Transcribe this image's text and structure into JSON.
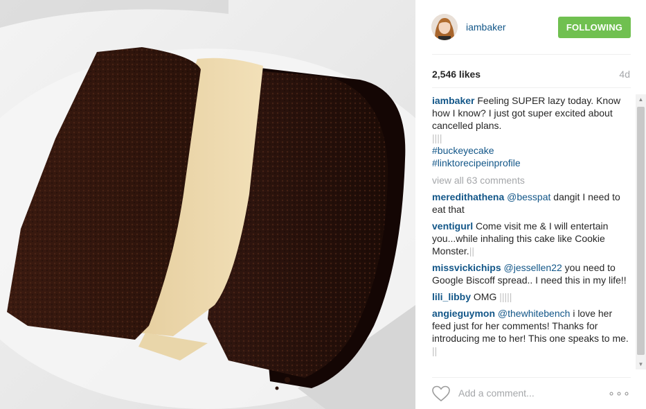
{
  "post": {
    "image_alt": "chocolate layer cake slice with peanut butter filling",
    "author": "iambaker",
    "follow_label": "FOLLOWING",
    "likes": "2,546 likes",
    "age": "4d"
  },
  "caption": {
    "user": "iambaker",
    "text": "Feeling SUPER lazy today. Know how I know? I just got super excited about cancelled plans.",
    "emoji_row": "||||",
    "tags": [
      "#buckeyecake",
      "#linktorecipeinprofile"
    ]
  },
  "view_all": "view all 63 comments",
  "comments": [
    {
      "user": "meredithathena",
      "mention": "@besspat",
      "text": "dangit I need to eat that"
    },
    {
      "user": "ventigurl",
      "mention": "",
      "text": "Come visit me & I will entertain you...while inhaling this cake like Cookie Monster.",
      "trail": "||"
    },
    {
      "user": "missvickichips",
      "mention": "@jessellen22",
      "text": "you need to Google Biscoff spread.. I need this in my life!!"
    },
    {
      "user": "lili_libby",
      "mention": "",
      "text": "OMG",
      "trail": "|||||"
    },
    {
      "user": "angieguymon",
      "mention": "@thewhitebench",
      "text": "i love her feed just for her comments! Thanks for introducing me to her! This one speaks to me.",
      "trail": "||"
    }
  ],
  "add_comment_placeholder": "Add a comment...",
  "icons": {
    "like": "heart-outline-icon",
    "more": "more-options-icon",
    "scroll_up": "scroll-up-arrow-icon",
    "scroll_down": "scroll-down-arrow-icon"
  },
  "colors": {
    "link": "#125688",
    "follow_button": "#70c050",
    "muted": "#a5a7aa"
  }
}
